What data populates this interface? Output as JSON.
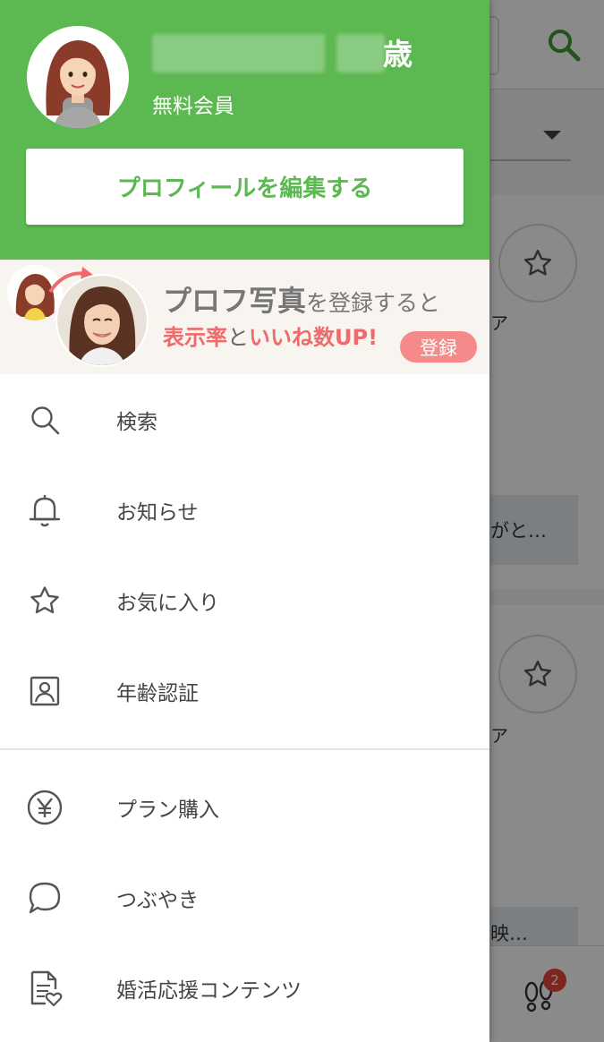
{
  "background": {
    "snippet_1": "がと…",
    "snippet_2": "映…",
    "fragment_1": "ア",
    "fragment_2": "ア",
    "footprint_badge": "2"
  },
  "drawer": {
    "age_suffix": "歳",
    "membership": "無料会員",
    "edit_profile_label": "プロフィールを編集する",
    "promo": {
      "title_bold": "プロフ写真",
      "title_rest": "を登録すると",
      "highlight_1": "表示率",
      "joiner": "と",
      "highlight_2": "いいね数UP!",
      "register_label": "登録"
    },
    "menu_primary": [
      {
        "icon": "search-icon",
        "label": "検索"
      },
      {
        "icon": "bell-icon",
        "label": "お知らせ"
      },
      {
        "icon": "star-icon",
        "label": "お気に入り"
      },
      {
        "icon": "id-card-icon",
        "label": "年齢認証"
      }
    ],
    "menu_secondary": [
      {
        "icon": "yen-icon",
        "label": "プラン購入"
      },
      {
        "icon": "chat-bubble-icon",
        "label": "つぶやき"
      },
      {
        "icon": "document-heart-icon",
        "label": "婚活応援コンテンツ"
      }
    ]
  },
  "colors": {
    "brand_green": "#5cb850",
    "promo_pink": "#ef6b6b",
    "badge_red": "#e8473a"
  }
}
